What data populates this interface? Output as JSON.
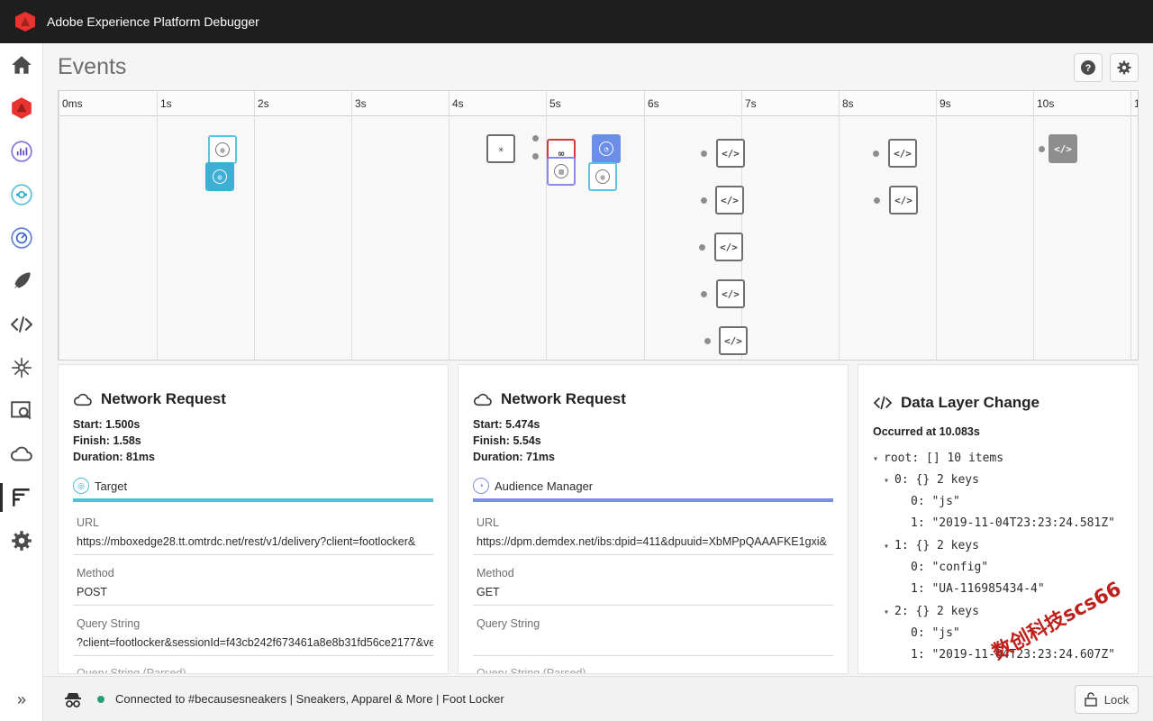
{
  "app": {
    "title": "Adobe Experience Platform Debugger",
    "logo_icon": "adobe-logo-icon"
  },
  "rail": {
    "items": [
      {
        "name": "home",
        "icon": "home-icon"
      },
      {
        "name": "experience-platform",
        "icon": "adobe-experience-platform-icon"
      },
      {
        "name": "analytics",
        "icon": "analytics-icon"
      },
      {
        "name": "target",
        "icon": "target-icon"
      },
      {
        "name": "audience-manager",
        "icon": "audience-manager-icon"
      },
      {
        "name": "launch",
        "icon": "launch-rocket-icon"
      },
      {
        "name": "data-layer",
        "icon": "code-icon"
      },
      {
        "name": "id-sync",
        "icon": "sparkle-icon"
      },
      {
        "name": "network",
        "icon": "network-search-icon"
      },
      {
        "name": "cloud",
        "icon": "cloud-icon"
      },
      {
        "name": "events",
        "icon": "events-timeline-icon",
        "active": true
      },
      {
        "name": "settings",
        "icon": "gear-icon"
      }
    ],
    "expand_label": "»"
  },
  "header": {
    "title": "Events",
    "help_icon": "help-icon",
    "settings_icon": "gear-icon"
  },
  "timeline": {
    "ticks": [
      "0ms",
      "1s",
      "2s",
      "3s",
      "4s",
      "5s",
      "6s",
      "7s",
      "8s",
      "9s",
      "10s",
      "1"
    ],
    "code_glyph": "</>"
  },
  "panels": [
    {
      "title": "Network Request",
      "icon": "cloud-icon",
      "start": "Start: 1.500s",
      "finish": "Finish: 1.58s",
      "duration": "Duration: 81ms",
      "solution": "Target",
      "solution_color": "#4fc1d9",
      "url_label": "URL",
      "url": "https://mboxedge28.tt.omtrdc.net/rest/v1/delivery?client=footlocker&",
      "method_label": "Method",
      "method": "POST",
      "query_label": "Query String",
      "query": "?client=footlocker&sessionId=f43cb242f673461a8e8b31fd56ce2177&ve",
      "parsed_label": "Query String (Parsed)"
    },
    {
      "title": "Network Request",
      "icon": "cloud-icon",
      "start": "Start: 5.474s",
      "finish": "Finish: 5.54s",
      "duration": "Duration: 71ms",
      "solution": "Audience Manager",
      "solution_color": "#7891e0",
      "url_label": "URL",
      "url": "https://dpm.demdex.net/ibs:dpid=411&dpuuid=XbMPpQAAAFKE1gxi&",
      "method_label": "Method",
      "method": "GET",
      "query_label": "Query String",
      "query": "",
      "parsed_label": "Query String (Parsed)"
    }
  ],
  "datalayer": {
    "title": "Data Layer Change",
    "icon": "code-icon",
    "occurred": "Occurred at 10.083s",
    "tree": [
      {
        "text": "root:  []  10 items",
        "arrow": "▾"
      },
      {
        "text": "0:  {}  2 keys",
        "arrow": "▾"
      },
      {
        "text": "0: \"js\"",
        "arrow": ""
      },
      {
        "text": "1: \"2019-11-04T23:23:24.581Z\"",
        "arrow": ""
      },
      {
        "text": "1:  {}  2 keys",
        "arrow": "▾"
      },
      {
        "text": "0: \"config\"",
        "arrow": ""
      },
      {
        "text": "1: \"UA-116985434-4\"",
        "arrow": ""
      },
      {
        "text": "2:  {}  2 keys",
        "arrow": "▾"
      },
      {
        "text": "0: \"js\"",
        "arrow": ""
      },
      {
        "text": "1: \"2019-11-04T23:23:24.607Z\"",
        "arrow": ""
      }
    ]
  },
  "statusbar": {
    "connection_text": "Connected to #becausesneakers | Sneakers, Apparel & More | Foot Locker",
    "lock_label": "Lock",
    "lock_icon": "lock-icon",
    "spy_icon": "incognito-icon"
  },
  "watermark": "数创科技scs66"
}
